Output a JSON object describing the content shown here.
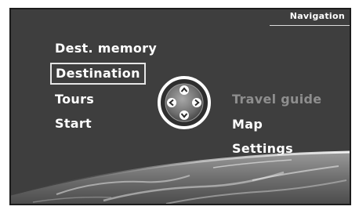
{
  "header": {
    "title": "Navigation"
  },
  "menu": {
    "left_items": [
      {
        "label": "Dest. memory",
        "selected": false
      },
      {
        "label": "Destination",
        "selected": true
      },
      {
        "label": "Tours",
        "selected": false
      },
      {
        "label": "Start",
        "selected": false
      }
    ],
    "right_items": [
      {
        "label": "Travel guide",
        "enabled": false
      },
      {
        "label": "Map",
        "enabled": true
      },
      {
        "label": "Settings",
        "enabled": true
      }
    ]
  },
  "controller": {
    "icons": [
      "arrow-up-icon",
      "arrow-left-icon",
      "arrow-right-icon",
      "arrow-down-icon"
    ]
  },
  "colors": {
    "background": "#3e3e3e",
    "text": "#ffffff",
    "disabled_text": "#8e8e8e",
    "highlight_frame": "#e6e6e6",
    "controller_ring": "#ffffff"
  }
}
